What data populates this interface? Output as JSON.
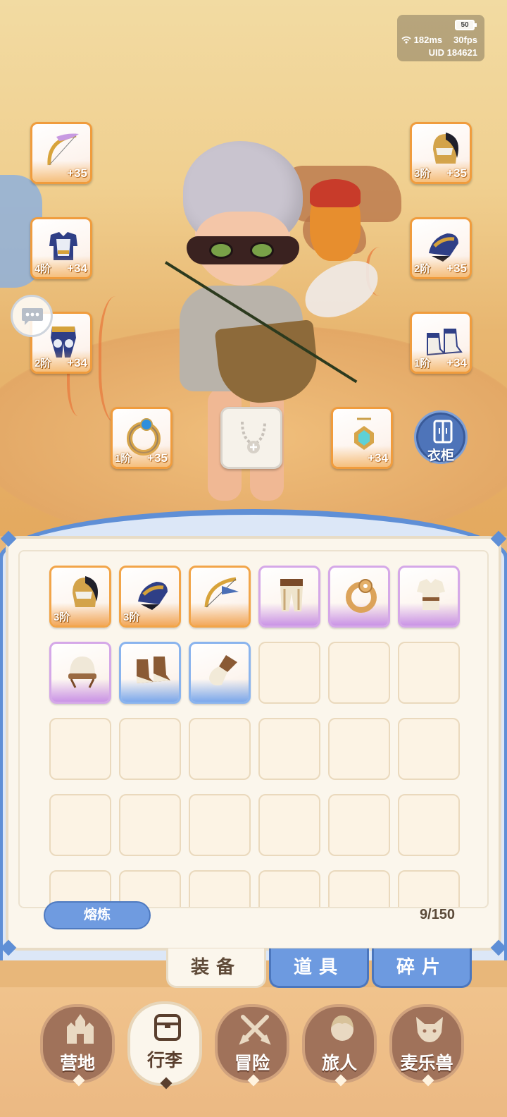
{
  "status": {
    "battery": "50",
    "ping": "182ms",
    "fps": "30fps",
    "uid": "UID 184621"
  },
  "equipped": {
    "bow": {
      "icon": "bow-icon",
      "tier": "",
      "plus": "+35"
    },
    "armor": {
      "icon": "armor-icon",
      "tier": "4阶",
      "plus": "+34"
    },
    "pants": {
      "icon": "leg-armor-icon",
      "tier": "2阶",
      "plus": "+34"
    },
    "ring": {
      "icon": "ring-icon",
      "tier": "1阶",
      "plus": "+35"
    },
    "necklace": {
      "icon": "necklace-icon",
      "tier": "",
      "plus": ""
    },
    "amulet": {
      "icon": "amulet-icon",
      "tier": "",
      "plus": "+34"
    },
    "helmet": {
      "icon": "helmet-icon",
      "tier": "3阶",
      "plus": "+35"
    },
    "gloves": {
      "icon": "gauntlet-icon",
      "tier": "2阶",
      "plus": "+35"
    },
    "boots": {
      "icon": "boots-icon",
      "tier": "1阶",
      "plus": "+34"
    }
  },
  "wardrobe": {
    "label": "衣柜",
    "icon": "wardrobe-icon"
  },
  "inventory": {
    "items": [
      {
        "icon": "helmet-icon",
        "tier": "3阶",
        "quality": "orange"
      },
      {
        "icon": "gauntlet-icon",
        "tier": "3阶",
        "quality": "orange"
      },
      {
        "icon": "bow-icon",
        "tier": "",
        "quality": "orange"
      },
      {
        "icon": "leg-armor-icon",
        "tier": "",
        "quality": "purple"
      },
      {
        "icon": "ring-icon",
        "tier": "",
        "quality": "purple"
      },
      {
        "icon": "tunic-icon",
        "tier": "",
        "quality": "purple"
      },
      {
        "icon": "cap-icon",
        "tier": "",
        "quality": "purple"
      },
      {
        "icon": "boots-icon",
        "tier": "",
        "quality": "blue"
      },
      {
        "icon": "glove-icon",
        "tier": "",
        "quality": "blue"
      }
    ],
    "smelt_label": "熔炼",
    "capacity": "9/150"
  },
  "tabs": {
    "equipment": "装备",
    "items": "道具",
    "fragments": "碎片"
  },
  "nav": {
    "camp": "营地",
    "luggage": "行李",
    "adventure": "冒险",
    "travelers": "旅人",
    "pets": "麦乐兽"
  },
  "colors": {
    "accent_blue": "#6f9be0",
    "orange_quality": "#f2a549",
    "purple_quality": "#c58ae6",
    "blue_quality": "#6fa1ec"
  }
}
